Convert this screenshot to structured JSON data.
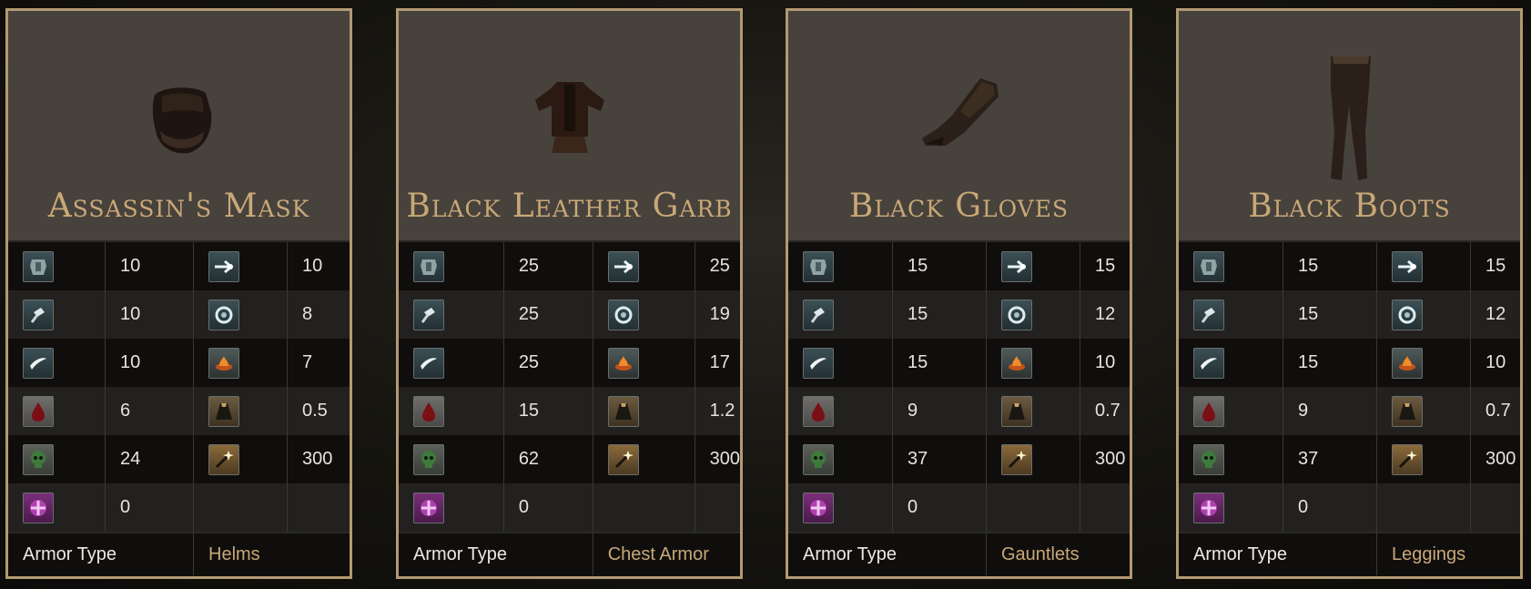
{
  "cards": [
    {
      "name": "Assassin's Mask",
      "armor_type_label": "Armor Type",
      "armor_type": "Helms",
      "rows": [
        [
          "10",
          "10"
        ],
        [
          "10",
          "8"
        ],
        [
          "10",
          "7"
        ],
        [
          "6",
          "0.5"
        ],
        [
          "24",
          "300"
        ],
        [
          "0",
          ""
        ]
      ]
    },
    {
      "name": "Black Leather Garb",
      "armor_type_label": "Armor Type",
      "armor_type": "Chest Armor",
      "rows": [
        [
          "25",
          "25"
        ],
        [
          "25",
          "19"
        ],
        [
          "25",
          "17"
        ],
        [
          "15",
          "1.2"
        ],
        [
          "62",
          "300"
        ],
        [
          "0",
          ""
        ]
      ]
    },
    {
      "name": "Black Gloves",
      "armor_type_label": "Armor Type",
      "armor_type": "Gauntlets",
      "rows": [
        [
          "15",
          "15"
        ],
        [
          "15",
          "12"
        ],
        [
          "15",
          "10"
        ],
        [
          "9",
          "0.7"
        ],
        [
          "37",
          "300"
        ],
        [
          "0",
          ""
        ]
      ]
    },
    {
      "name": "Black Boots",
      "armor_type_label": "Armor Type",
      "armor_type": "Leggings",
      "rows": [
        [
          "15",
          "15"
        ],
        [
          "15",
          "12"
        ],
        [
          "15",
          "10"
        ],
        [
          "9",
          "0.7"
        ],
        [
          "37",
          "300"
        ],
        [
          "0",
          ""
        ]
      ]
    }
  ],
  "icons": {
    "left": [
      "armor-icon",
      "hammer-icon",
      "blade-icon",
      "blood-drop-icon",
      "skull-icon",
      "magic-cross-icon"
    ],
    "right": [
      "pierce-arrow-icon",
      "swirl-icon",
      "fire-icon",
      "cloak-weight-icon",
      "wand-icon"
    ]
  }
}
